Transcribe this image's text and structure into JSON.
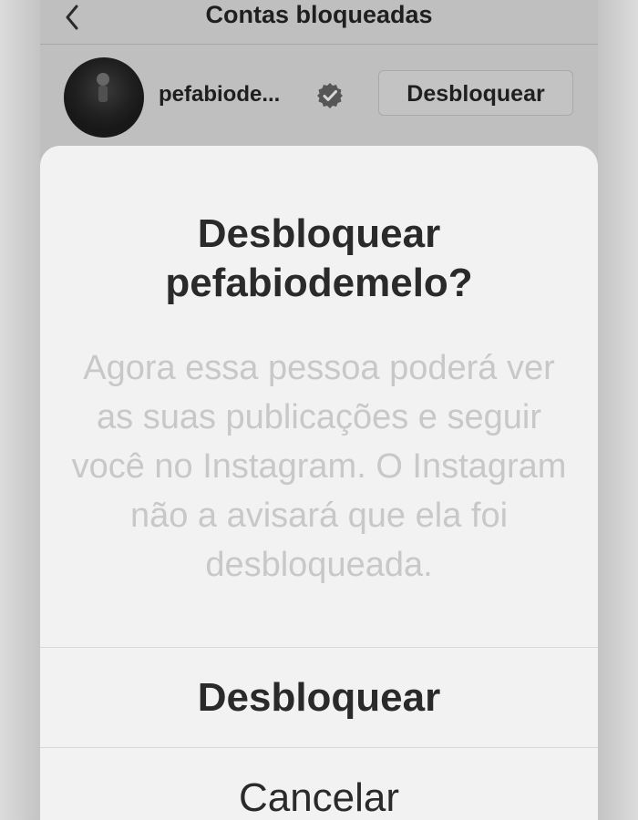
{
  "header": {
    "title": "Contas bloqueadas",
    "back_icon": "chevron-left-icon"
  },
  "blocked_list": {
    "items": [
      {
        "username": "pefabiode...",
        "verified_icon": "verified-badge-icon",
        "action_label": "Desbloquear"
      }
    ]
  },
  "dialog": {
    "title": "Desbloquear pefabiodemelo?",
    "body": "Agora essa pessoa poderá ver as suas publicações e seguir você no Instagram. O Instagram não a avisará que ela foi desbloqueada.",
    "confirm_label": "Desbloquear",
    "cancel_label": "Cancelar"
  },
  "colors": {
    "overlay": "#bfbfbf",
    "sheet": "#f2f2f2",
    "text_primary": "#2a2a2a",
    "text_muted": "#c8c8c8"
  }
}
